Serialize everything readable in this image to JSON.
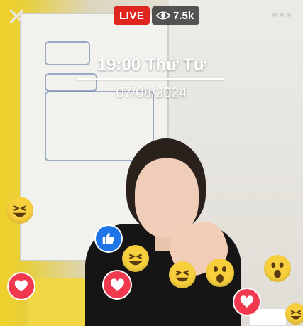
{
  "stream": {
    "live_label": "LIVE",
    "viewer_count": "7.5k"
  },
  "overlay": {
    "time_text": "19:00 Thứ Tư",
    "date_text": "07/08/2024"
  },
  "icons": {
    "close": "close-icon",
    "viewers": "eye-icon",
    "more": "more-options-icon",
    "reactions": [
      "laugh-emoji",
      "like-icon",
      "laugh-emoji",
      "laugh-emoji",
      "wow-emoji",
      "wow-emoji",
      "heart-icon",
      "heart-icon",
      "heart-icon",
      "laugh-emoji"
    ]
  },
  "colors": {
    "live_red": "#e0251e",
    "heart_red": "#f0384f",
    "like_blue": "#1f74e8",
    "emoji_yellow": "#f7cf3c"
  }
}
